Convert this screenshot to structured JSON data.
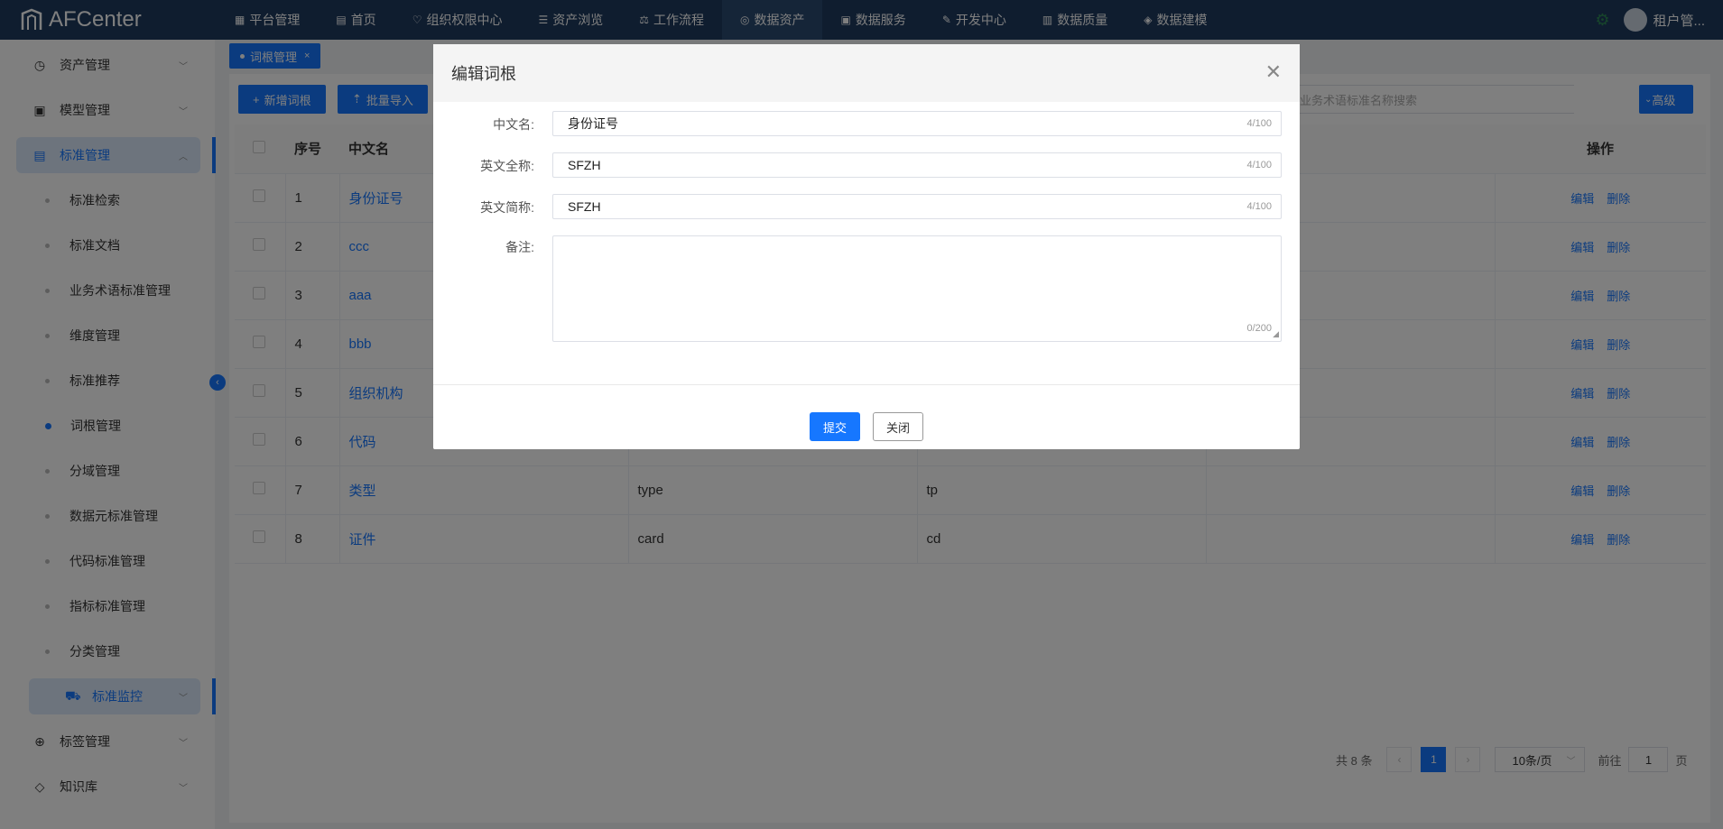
{
  "app": {
    "logo": "AFCenter"
  },
  "topnav": [
    {
      "label": "平台管理",
      "icon": "grid-icon"
    },
    {
      "label": "首页",
      "icon": "document-icon"
    },
    {
      "label": "组织权限中心",
      "icon": "shield-icon"
    },
    {
      "label": "资产浏览",
      "icon": "list-icon"
    },
    {
      "label": "工作流程",
      "icon": "scale-icon"
    },
    {
      "label": "数据资产",
      "icon": "database-icon",
      "active": true
    },
    {
      "label": "数据服务",
      "icon": "pulse-icon"
    },
    {
      "label": "开发中心",
      "icon": "edit-icon"
    },
    {
      "label": "数据质量",
      "icon": "bar-chart-icon"
    },
    {
      "label": "数据建模",
      "icon": "layers-icon"
    }
  ],
  "user": {
    "name": "租户管..."
  },
  "sidebar": {
    "top": [
      {
        "label": "资产管理",
        "icon": "clock-icon"
      },
      {
        "label": "模型管理",
        "icon": "chart-icon"
      },
      {
        "label": "标准管理",
        "icon": "doc-icon"
      }
    ],
    "sub": [
      "标准检索",
      "标准文档",
      "业务术语标准管理",
      "维度管理",
      "标准推荐",
      "词根管理",
      "分域管理",
      "数据元标准管理",
      "代码标准管理",
      "指标标准管理",
      "分类管理"
    ],
    "active_sub": "词根管理",
    "monitor": "标准监控",
    "bottom": [
      {
        "label": "标签管理",
        "icon": "plus-circle-icon"
      },
      {
        "label": "知识库",
        "icon": "tag-icon"
      }
    ]
  },
  "tab": {
    "label": "词根管理"
  },
  "toolbar": {
    "add_label": "新增词根",
    "import_label": "批量导入",
    "search_placeholder": "入业务术语标准名称搜索",
    "advanced_label": "高级"
  },
  "table": {
    "headers": {
      "index": "序号",
      "cn_name": "中文名",
      "actions": "操作"
    },
    "rows": [
      {
        "no": "1",
        "cn": "身份证号",
        "en_full": "",
        "en_short": ""
      },
      {
        "no": "2",
        "cn": "ccc",
        "en_full": "",
        "en_short": ""
      },
      {
        "no": "3",
        "cn": "aaa",
        "en_full": "",
        "en_short": ""
      },
      {
        "no": "4",
        "cn": "bbb",
        "en_full": "",
        "en_short": ""
      },
      {
        "no": "5",
        "cn": "组织机构",
        "en_full": "",
        "en_short": ""
      },
      {
        "no": "6",
        "cn": "代码",
        "en_full": "",
        "en_short": ""
      },
      {
        "no": "7",
        "cn": "类型",
        "en_full": "type",
        "en_short": "tp"
      },
      {
        "no": "8",
        "cn": "证件",
        "en_full": "card",
        "en_short": "cd"
      }
    ],
    "edit_label": "编辑",
    "delete_label": "删除"
  },
  "pagination": {
    "total": "共 8 条",
    "current": "1",
    "page_size": "10条/页",
    "goto_prefix": "前往",
    "goto_value": "1",
    "goto_suffix": "页"
  },
  "dialog": {
    "title": "编辑词根",
    "fields": {
      "cn_name": {
        "label": "中文名:",
        "value": "身份证号",
        "count": "4/100"
      },
      "en_full": {
        "label": "英文全称:",
        "value": "SFZH",
        "count": "4/100"
      },
      "en_short": {
        "label": "英文简称:",
        "value": "SFZH",
        "count": "4/100"
      },
      "remark": {
        "label": "备注:",
        "value": "",
        "count": "0/200"
      }
    },
    "submit_label": "提交",
    "close_label": "关闭"
  }
}
